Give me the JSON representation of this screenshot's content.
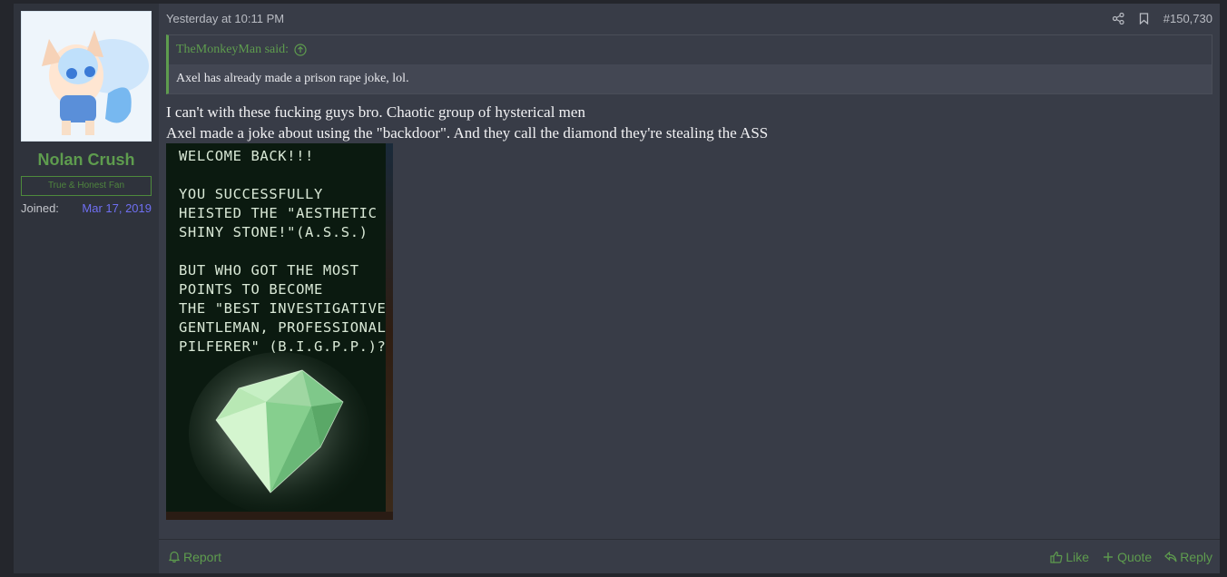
{
  "post": {
    "author": {
      "name": "Nolan Crush",
      "title": "True & Honest Fan",
      "joined_label": "Joined:",
      "joined_value": "Mar 17, 2019"
    },
    "date": "Yesterday at 10:11 PM",
    "post_number": "#150,730",
    "quote": {
      "author_said": "TheMonkeyMan said:",
      "text": "Axel has already made a prison rape joke, lol."
    },
    "message_lines": [
      "I can't with these fucking guys bro. Chaotic group of hysterical men",
      "Axel made a joke about using the \"backdoor\". And they call the diamond they're stealing the ASS"
    ],
    "image_text": "WELCOME BACK!!!\n\nYOU SUCCESSFULLY\nHEISTED THE \"AESTHETIC\nSHINY STONE!\"(A.S.S.)\n\nBUT WHO GOT THE MOST\nPOINTS TO BECOME\nTHE \"BEST INVESTIGATIVE\nGENTLEMAN, PROFESSIONAL\nPILFERER\" (B.I.G.P.P.)?",
    "footer": {
      "report": "Report",
      "like": "Like",
      "quote": "Quote",
      "reply": "Reply"
    }
  },
  "icons": {
    "share": "share-icon",
    "bookmark": "bookmark-icon",
    "quote_up": "arrow-up-circle-icon",
    "report": "bell-icon",
    "like": "thumbs-up-icon",
    "quote": "plus-icon",
    "reply": "reply-icon"
  },
  "colors": {
    "accent": "#5e9c4e",
    "joined_date": "#6f6ff2",
    "background": "#383c47",
    "sidebar": "#2f333c"
  }
}
